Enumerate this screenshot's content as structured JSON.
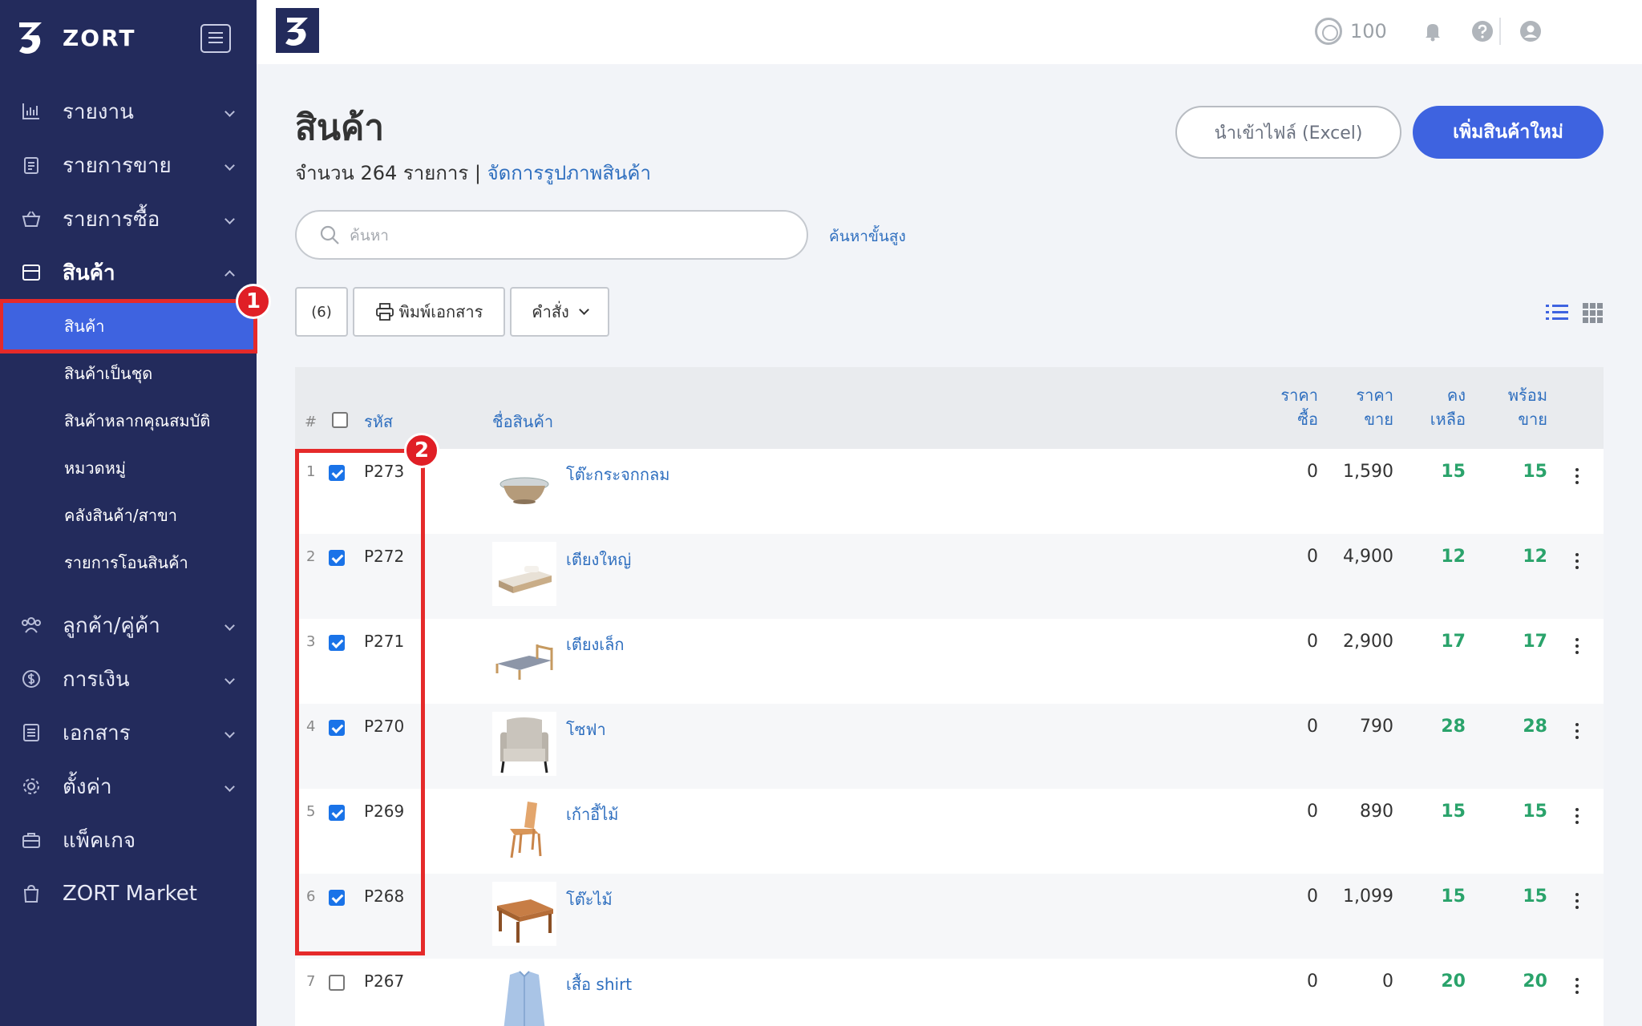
{
  "brand": {
    "name": "ZORT"
  },
  "sidebar": {
    "items": [
      {
        "label": "รายงาน",
        "icon": "chart-icon"
      },
      {
        "label": "รายการขาย",
        "icon": "clipboard-icon"
      },
      {
        "label": "รายการซื้อ",
        "icon": "basket-icon"
      },
      {
        "label": "สินค้า",
        "icon": "box-icon"
      },
      {
        "label": "ลูกค้า/คู่ค้า",
        "icon": "users-icon"
      },
      {
        "label": "การเงิน",
        "icon": "dollar-icon"
      },
      {
        "label": "เอกสาร",
        "icon": "document-icon"
      },
      {
        "label": "ตั้งค่า",
        "icon": "gear-icon"
      },
      {
        "label": "แพ็คเกจ",
        "icon": "briefcase-icon"
      },
      {
        "label": "ZORT Market",
        "icon": "shopping-bag-icon"
      }
    ],
    "sub_items": [
      {
        "label": "สินค้า"
      },
      {
        "label": "สินค้าเป็นชุด"
      },
      {
        "label": "สินค้าหลากคุณสมบัติ"
      },
      {
        "label": "หมวดหมู่"
      },
      {
        "label": "คลังสินค้า/สาขา"
      },
      {
        "label": "รายการโอนสินค้า"
      }
    ]
  },
  "markers": {
    "one": "1",
    "two": "2"
  },
  "topbar": {
    "credits": "100"
  },
  "page": {
    "title": "สินค้า",
    "count_text": "จำนวน 264 รายการ | ",
    "manage_images_link": "จัดการรูปภาพสินค้า",
    "import_button": "นำเข้าไฟล์ (Excel)",
    "add_button": "เพิ่มสินค้าใหม่"
  },
  "search": {
    "placeholder": "ค้นหา",
    "advanced_link": "ค้นหาขั้นสูง"
  },
  "toolbar": {
    "selected_count": "(6)",
    "print_label": "พิมพ์เอกสาร",
    "command_label": "คำสั่ง"
  },
  "table": {
    "headers": {
      "index": "#",
      "code": "รหัส",
      "name": "ชื่อสินค้า",
      "buy_line1": "ราคา",
      "buy_line2": "ซื้อ",
      "sell_line1": "ราคา",
      "sell_line2": "ขาย",
      "remain_line1": "คง",
      "remain_line2": "เหลือ",
      "ready_line1": "พร้อม",
      "ready_line2": "ขาย"
    },
    "rows": [
      {
        "index": "1",
        "code": "P273",
        "name": "โต๊ะกระจกกลม",
        "buy": "0",
        "sell": "1,590",
        "remain": "15",
        "ready": "15",
        "checked": true
      },
      {
        "index": "2",
        "code": "P272",
        "name": "เตียงใหญ่",
        "buy": "0",
        "sell": "4,900",
        "remain": "12",
        "ready": "12",
        "checked": true
      },
      {
        "index": "3",
        "code": "P271",
        "name": "เตียงเล็ก",
        "buy": "0",
        "sell": "2,900",
        "remain": "17",
        "ready": "17",
        "checked": true
      },
      {
        "index": "4",
        "code": "P270",
        "name": "โซฟา",
        "buy": "0",
        "sell": "790",
        "remain": "28",
        "ready": "28",
        "checked": true
      },
      {
        "index": "5",
        "code": "P269",
        "name": "เก้าอี้ไม้",
        "buy": "0",
        "sell": "890",
        "remain": "15",
        "ready": "15",
        "checked": true
      },
      {
        "index": "6",
        "code": "P268",
        "name": "โต๊ะไม้",
        "buy": "0",
        "sell": "1,099",
        "remain": "15",
        "ready": "15",
        "checked": true
      },
      {
        "index": "7",
        "code": "P267",
        "name": "เสื้อ shirt",
        "buy": "0",
        "sell": "0",
        "remain": "20",
        "ready": "20",
        "checked": false
      }
    ]
  },
  "colors": {
    "sidebar_bg": "#232b5c",
    "accent": "#3e63e0",
    "highlight": "#e52a2a",
    "stock_green": "#2aa36b",
    "link_blue": "#2f6fbf"
  }
}
